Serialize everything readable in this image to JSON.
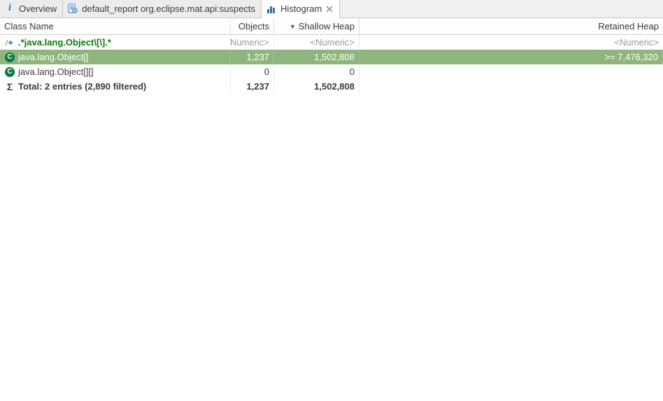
{
  "tabs": [
    {
      "label": "Overview",
      "icon": "info-icon"
    },
    {
      "label": "default_report  org.eclipse.mat.api:suspects",
      "icon": "report-icon"
    },
    {
      "label": "Histogram",
      "icon": "histogram-icon",
      "active": true,
      "closeable": true
    }
  ],
  "columns": {
    "classname": "Class Name",
    "objects": "Objects",
    "shallow": "Shallow Heap",
    "retained": "Retained Heap",
    "sort_column": "shallow",
    "sort_dir": "desc"
  },
  "filter_row": {
    "regex": ".*java.lang.Object\\[\\].*",
    "numeric_placeholder": "<Numeric>"
  },
  "rows": [
    {
      "icon": "class-badge",
      "classname": "java.lang.Object[]",
      "objects": "1,237",
      "shallow": "1,502,808",
      "retained": ">= 7,476,320",
      "selected": true
    },
    {
      "icon": "class-badge",
      "classname": "java.lang.Object[][]",
      "objects": "0",
      "shallow": "0",
      "retained": "",
      "selected": false
    }
  ],
  "total_row": {
    "label": "Total: 2 entries (2,890 filtered)",
    "objects": "1,237",
    "shallow": "1,502,808",
    "retained": ""
  }
}
